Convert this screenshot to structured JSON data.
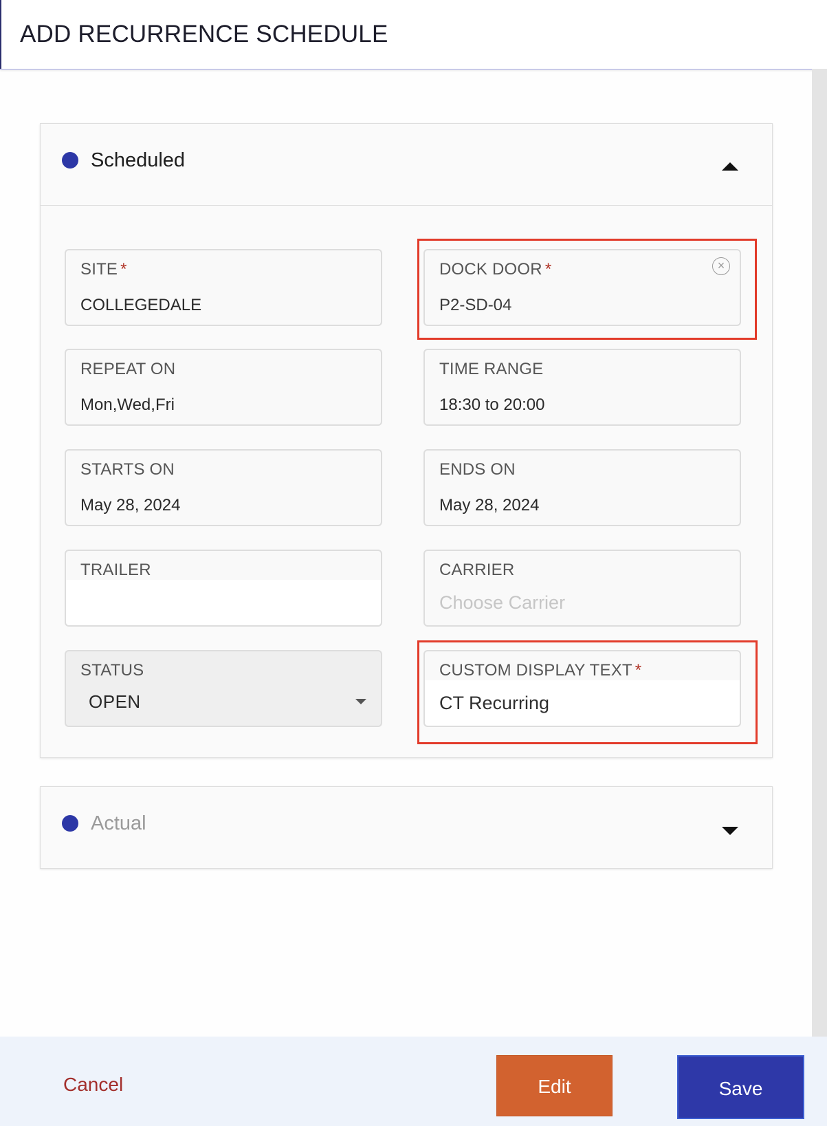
{
  "dialog": {
    "title": "ADD RECURRENCE SCHEDULE"
  },
  "colors": {
    "accent": "#2c37a6",
    "required": "#b03326",
    "highlight": "#e23b2a",
    "edit_button": "#d2622f",
    "save_button": "#2e38a8",
    "cancel_text": "#a32f2c"
  },
  "scheduled": {
    "title": "Scheduled",
    "expanded": true,
    "fields": {
      "site": {
        "label": "SITE",
        "required": "*",
        "value": "COLLEGEDALE"
      },
      "dock_door": {
        "label": "DOCK DOOR",
        "required": "*",
        "value": "P2-SD-04",
        "clear_icon": "×"
      },
      "repeat_on": {
        "label": "REPEAT ON",
        "value": "Mon,Wed,Fri"
      },
      "time_range": {
        "label": "TIME RANGE",
        "value": "18:30 to 20:00"
      },
      "starts_on": {
        "label": "STARTS ON",
        "value": "May 28, 2024"
      },
      "ends_on": {
        "label": "ENDS ON",
        "value": "May 28, 2024"
      },
      "trailer": {
        "label": "TRAILER",
        "value": ""
      },
      "carrier": {
        "label": "CARRIER",
        "placeholder": "Choose Carrier"
      },
      "status": {
        "label": "STATUS",
        "value": "OPEN"
      },
      "custom_display_text": {
        "label": "CUSTOM DISPLAY TEXT",
        "required": "*",
        "value": "CT Recurring"
      }
    }
  },
  "actual": {
    "title": "Actual",
    "expanded": false
  },
  "footer": {
    "cancel_label": "Cancel",
    "edit_label": "Edit",
    "save_label": "Save"
  }
}
